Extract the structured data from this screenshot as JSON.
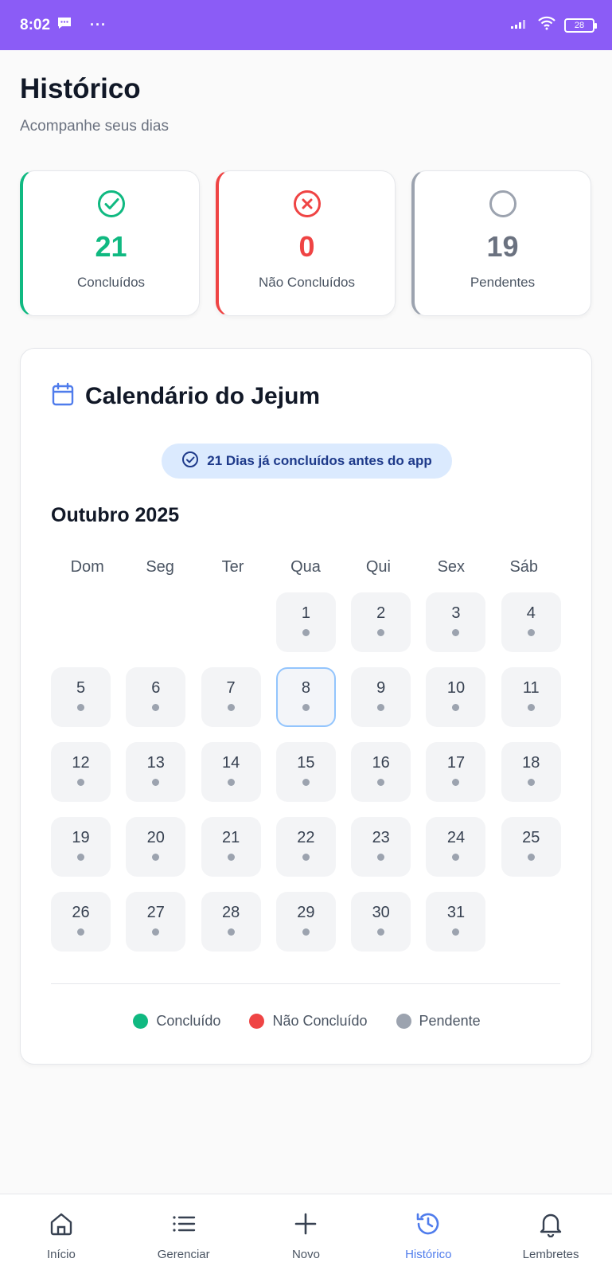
{
  "status_bar": {
    "time": "8:02",
    "dots": "···",
    "battery": "28"
  },
  "header": {
    "title": "Histórico",
    "subtitle": "Acompanhe seus dias"
  },
  "stats": {
    "completed": {
      "value": "21",
      "label": "Concluídos",
      "color": "#10b981"
    },
    "not_completed": {
      "value": "0",
      "label": "Não Concluídos",
      "color": "#ef4444"
    },
    "pending": {
      "value": "19",
      "label": "Pendentes",
      "color": "#9ca3af"
    }
  },
  "calendar": {
    "title": "Calendário do Jejum",
    "badge": "21 Dias já concluídos antes do app",
    "month": "Outubro 2025",
    "weekdays": [
      "Dom",
      "Seg",
      "Ter",
      "Qua",
      "Qui",
      "Sex",
      "Sáb"
    ],
    "days": [
      "1",
      "2",
      "3",
      "4",
      "5",
      "6",
      "7",
      "8",
      "9",
      "10",
      "11",
      "12",
      "13",
      "14",
      "15",
      "16",
      "17",
      "18",
      "19",
      "20",
      "21",
      "22",
      "23",
      "24",
      "25",
      "26",
      "27",
      "28",
      "29",
      "30",
      "31"
    ],
    "today": "8",
    "legend": {
      "completed": "Concluído",
      "not_completed": "Não Concluído",
      "pending": "Pendente"
    }
  },
  "nav": {
    "items": [
      {
        "label": "Início",
        "icon": "home-icon"
      },
      {
        "label": "Gerenciar",
        "icon": "list-icon"
      },
      {
        "label": "Novo",
        "icon": "plus-icon"
      },
      {
        "label": "Histórico",
        "icon": "history-icon",
        "active": true
      },
      {
        "label": "Lembretes",
        "icon": "bell-icon"
      }
    ]
  },
  "colors": {
    "status_bar": "#8b5cf6",
    "accent": "#4f7cec",
    "green": "#10b981",
    "red": "#ef4444",
    "gray": "#9ca3af"
  }
}
